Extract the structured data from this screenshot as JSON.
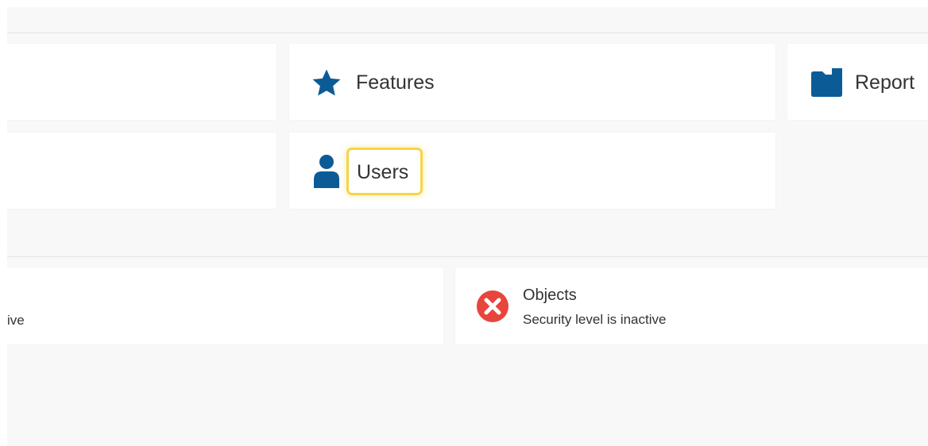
{
  "tiles": {
    "features": {
      "label": "Features",
      "icon": "star-icon"
    },
    "reports": {
      "label": "Report",
      "icon": "folder-icon"
    },
    "users": {
      "label": "Users",
      "icon": "user-icon"
    }
  },
  "security": {
    "left": {
      "subtitle": "ive"
    },
    "objects": {
      "title": "Objects",
      "subtitle": "Security level is inactive",
      "icon": "error-circle-icon"
    }
  },
  "colors": {
    "accent": "#0b5c96",
    "highlight": "#f5d547",
    "error": "#e8453c",
    "background": "#f8f8f8",
    "card": "#ffffff"
  }
}
